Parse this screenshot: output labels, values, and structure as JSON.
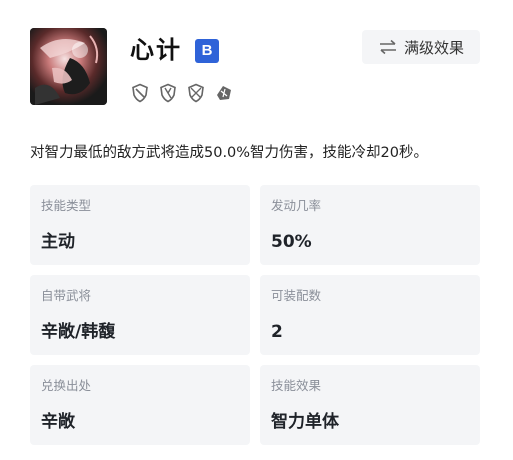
{
  "skill": {
    "name": "心计",
    "grade": "B",
    "icon": "skill-portrait-icon",
    "troop_icons": [
      "cavalry-shield-icon",
      "shield-icon",
      "bow-icon",
      "mechanism-icon"
    ]
  },
  "header": {
    "max_button_label": "满级效果",
    "max_button_icon": "swap-arrows-icon"
  },
  "description": "对智力最低的敌方武将造成50.0%智力伤害，技能冷却20秒。",
  "info_cards": [
    {
      "label": "技能类型",
      "value": "主动"
    },
    {
      "label": "发动几率",
      "value": "50%"
    },
    {
      "label": "自带武将",
      "value": "辛敞/韩馥"
    },
    {
      "label": "可装配数",
      "value": "2"
    },
    {
      "label": "兑换出处",
      "value": "辛敞"
    },
    {
      "label": "技能效果",
      "value": "智力单体"
    }
  ],
  "colors": {
    "badge": "#2f63d8",
    "card_bg": "#f4f5f7",
    "label": "#8a8f99"
  }
}
